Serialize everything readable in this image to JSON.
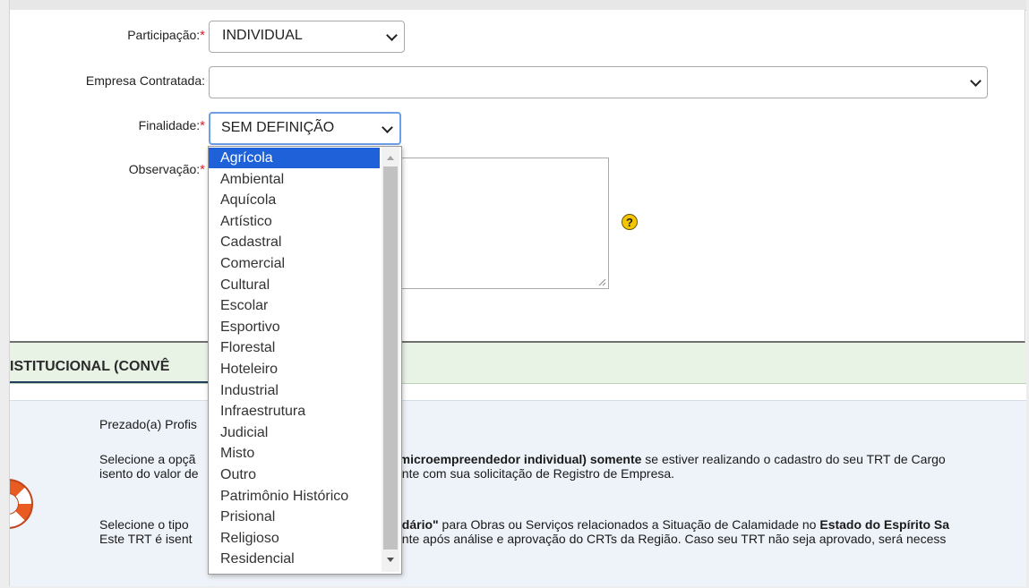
{
  "form": {
    "participacao": {
      "label": "Participação:",
      "required": "*",
      "value": "INDIVIDUAL"
    },
    "empresa": {
      "label": "Empresa Contratada:",
      "value": ""
    },
    "finalidade": {
      "label": "Finalidade:",
      "required": "*",
      "value": "SEM DEFINIÇÃO"
    },
    "observacao": {
      "label": "Observação:",
      "required": "*"
    },
    "help_icon": "?"
  },
  "section": {
    "title": "ISTITUCIONAL (CONVÊ"
  },
  "info": {
    "greeting": "Prezado(a) Profis",
    "p1_line1_a": "Selecione a opçã",
    "p1_line1_bold": "(microempreendedor individual) somente",
    "p1_line1_b": " se estiver realizando o cadastro do seu TRT de Cargo",
    "p1_line2_a": "isento do valor de",
    "p1_line2_b": "ente com sua solicitação de Registro de Empresa.",
    "p2_line1_a": "Selecione o tipo",
    "p2_line1_bold": "lidário\"",
    "p2_line1_b": " para Obras ou Serviços relacionados a Situação de Calamidade no ",
    "p2_line1_bold2": "Estado do Espírito Sa",
    "p2_line2_a": "Este TRT é isent",
    "p2_line2_b": "ente após análise e aprovação do CRTs da Região. Caso seu TRT não seja aprovado, será necess"
  },
  "dropdown": {
    "selected_index": 0,
    "options": [
      "Agrícola",
      "Ambiental",
      "Aquícola",
      "Artístico",
      "Cadastral",
      "Comercial",
      "Cultural",
      "Escolar",
      "Esportivo",
      "Florestal",
      "Hoteleiro",
      "Industrial",
      "Infraestrutura",
      "Judicial",
      "Misto",
      "Outro",
      "Patrimônio Histórico",
      "Prisional",
      "Religioso",
      "Residencial"
    ]
  },
  "colors": {
    "selection": "#1e61d8",
    "required": "#d8222f",
    "section_bg": "#e8f3e6",
    "info_bg": "#eef3f9"
  }
}
